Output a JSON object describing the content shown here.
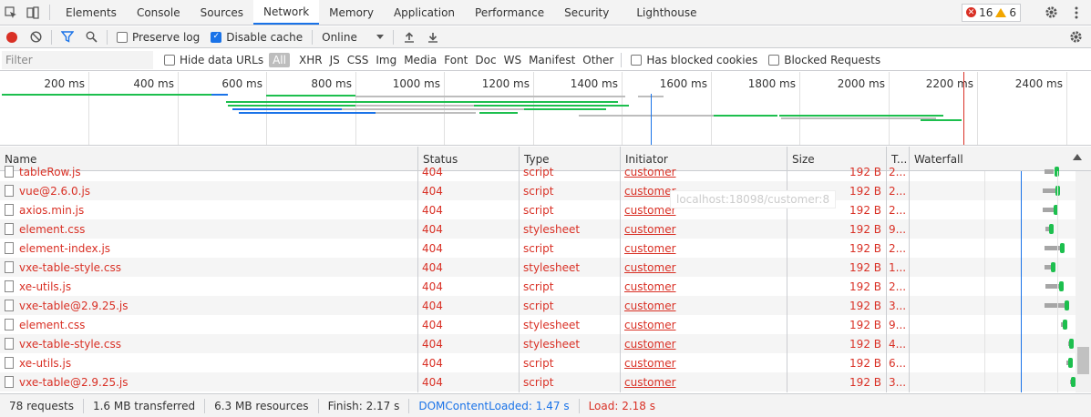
{
  "tabs": [
    {
      "label": "Elements"
    },
    {
      "label": "Console"
    },
    {
      "label": "Sources"
    },
    {
      "label": "Network"
    },
    {
      "label": "Memory"
    },
    {
      "label": "Application"
    },
    {
      "label": "Performance"
    },
    {
      "label": "Security"
    },
    {
      "label": "Lighthouse"
    }
  ],
  "active_tab": "Network",
  "issues": {
    "errors": "16",
    "warnings": "6"
  },
  "toolbar": {
    "preserve_log": "Preserve log",
    "disable_cache": "Disable cache",
    "throttle": "Online"
  },
  "filter": {
    "placeholder": "Filter",
    "hide_data_urls": "Hide data URLs",
    "types": [
      "All",
      "XHR",
      "JS",
      "CSS",
      "Img",
      "Media",
      "Font",
      "Doc",
      "WS",
      "Manifest",
      "Other"
    ],
    "has_blocked_cookies": "Has blocked cookies",
    "blocked_requests": "Blocked Requests"
  },
  "overview": {
    "ticks": [
      "200 ms",
      "400 ms",
      "600 ms",
      "800 ms",
      "1000 ms",
      "1200 ms",
      "1400 ms",
      "1600 ms",
      "1800 ms",
      "2000 ms",
      "2200 ms",
      "2400 ms"
    ]
  },
  "columns": {
    "name": "Name",
    "status": "Status",
    "type": "Type",
    "initiator": "Initiator",
    "size": "Size",
    "time": "T...",
    "waterfall": "Waterfall"
  },
  "tooltip": "localhost:18098/customer:8",
  "rows": [
    {
      "name": "tableRow.js",
      "status": "404",
      "type": "script",
      "initiator": "customer",
      "size": "192 B",
      "time": "2..."
    },
    {
      "name": "vue@2.6.0.js",
      "status": "404",
      "type": "script",
      "initiator": "customer",
      "size": "192 B",
      "time": "2..."
    },
    {
      "name": "axios.min.js",
      "status": "404",
      "type": "script",
      "initiator": "customer",
      "size": "192 B",
      "time": "2..."
    },
    {
      "name": "element.css",
      "status": "404",
      "type": "stylesheet",
      "initiator": "customer",
      "size": "192 B",
      "time": "9..."
    },
    {
      "name": "element-index.js",
      "status": "404",
      "type": "script",
      "initiator": "customer",
      "size": "192 B",
      "time": "2..."
    },
    {
      "name": "vxe-table-style.css",
      "status": "404",
      "type": "stylesheet",
      "initiator": "customer",
      "size": "192 B",
      "time": "1..."
    },
    {
      "name": "xe-utils.js",
      "status": "404",
      "type": "script",
      "initiator": "customer",
      "size": "192 B",
      "time": "2..."
    },
    {
      "name": "vxe-table@2.9.25.js",
      "status": "404",
      "type": "script",
      "initiator": "customer",
      "size": "192 B",
      "time": "3..."
    },
    {
      "name": "element.css",
      "status": "404",
      "type": "stylesheet",
      "initiator": "customer",
      "size": "192 B",
      "time": "9..."
    },
    {
      "name": "vxe-table-style.css",
      "status": "404",
      "type": "stylesheet",
      "initiator": "customer",
      "size": "192 B",
      "time": "4..."
    },
    {
      "name": "xe-utils.js",
      "status": "404",
      "type": "script",
      "initiator": "customer",
      "size": "192 B",
      "time": "6..."
    },
    {
      "name": "vxe-table@2.9.25.js",
      "status": "404",
      "type": "script",
      "initiator": "customer",
      "size": "192 B",
      "time": "3..."
    }
  ],
  "status": {
    "requests": "78 requests",
    "transferred": "1.6 MB transferred",
    "resources": "6.3 MB resources",
    "finish": "Finish: 2.17 s",
    "dcl": "DOMContentLoaded: 1.47 s",
    "load": "Load: 2.18 s"
  },
  "colors": {
    "accent": "#1a73e8",
    "error": "#d93025",
    "receive": "#1dbf4e",
    "wait": "#a6a6a6"
  }
}
